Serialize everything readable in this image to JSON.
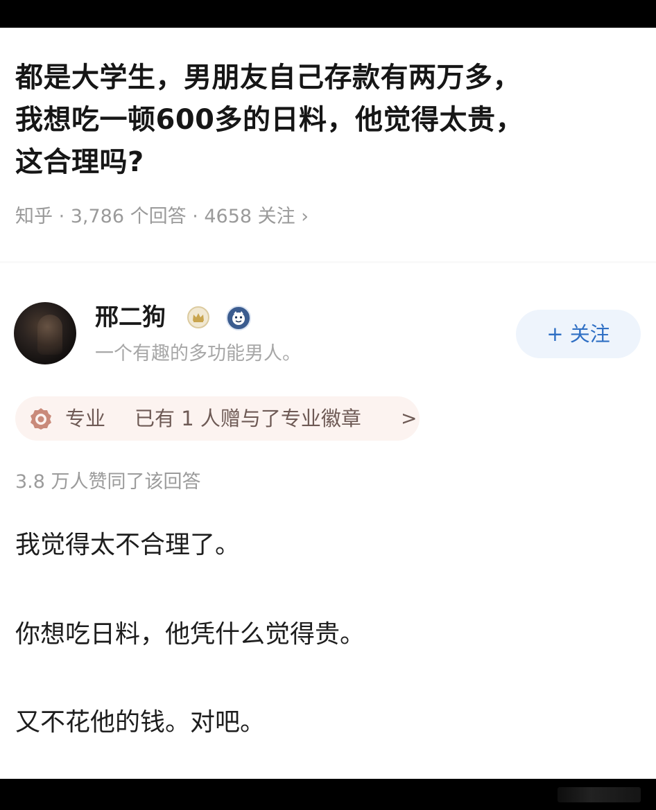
{
  "question": {
    "title_lines": [
      "都是大学生，男朋友自己存款有两万多，",
      "我想吃一顿600多的日料，他觉得太贵，",
      "这合理吗?"
    ],
    "meta": "知乎 · 3,786 个回答 · 4658 关注 ›"
  },
  "author": {
    "name": "邢二狗",
    "bio": "一个有趣的多功能男人。",
    "follow_label": "+ 关注"
  },
  "pro_badge": {
    "label": "专业",
    "text": "已有 1 人赠与了专业徽章",
    "chevron": ">"
  },
  "answer": {
    "votes": "3.8 万人赞同了该回答",
    "paragraphs": [
      "我觉得太不合理了。",
      "你想吃日料，他凭什么觉得贵。",
      "又不花他的钱。对吧。"
    ]
  },
  "icons": {
    "crown_badge": "crown-badge-icon",
    "mascot_badge": "mascot-badge-icon",
    "pro_badge": "pro-badge-icon",
    "avatar": "avatar-image"
  },
  "colors": {
    "accent_blue": "#2f6fc4",
    "follow_bg": "#eef4fc",
    "pro_bg": "#fcf3f0",
    "meta_gray": "#9a9a9a"
  }
}
